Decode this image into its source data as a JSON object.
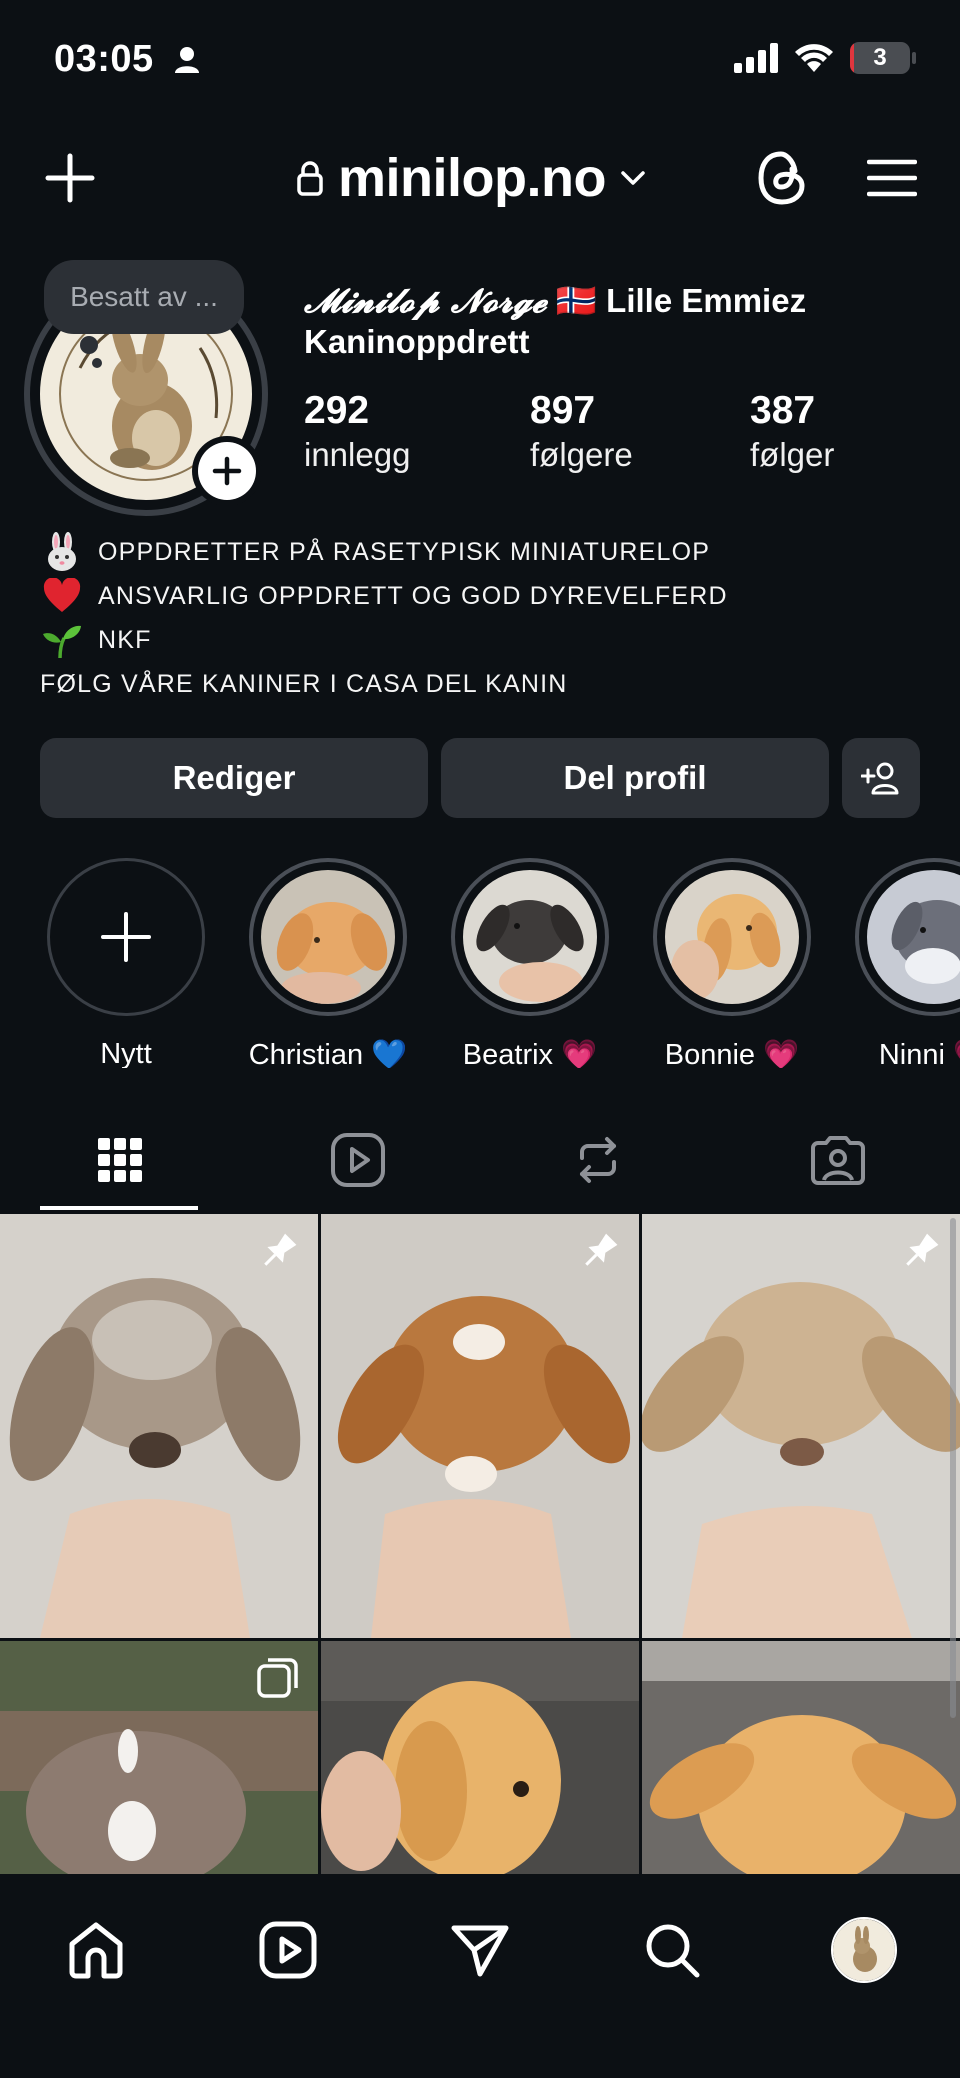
{
  "status_bar": {
    "time": "03:05",
    "battery_level": "3",
    "battery_fraction": 0.03
  },
  "header": {
    "username": "minilop.no",
    "icons": [
      "create-icon",
      "lock-icon",
      "chevron-down-icon",
      "threads-icon",
      "menu-icon"
    ]
  },
  "profile": {
    "note": "Besatt av ...",
    "display_name_script": "𝓜𝓲𝓷𝓲𝓵𝓸𝓹 𝓝𝓸𝓻𝓰𝓮",
    "display_name_flag": "🇳🇴",
    "display_name_rest": "Lille Emmiez Kaninoppdrett",
    "stats": [
      {
        "value": "292",
        "label": "innlegg"
      },
      {
        "value": "897",
        "label": "følgere"
      },
      {
        "value": "387",
        "label": "følger"
      }
    ],
    "bio": [
      {
        "emoji": "rabbit-face",
        "text": "OPPDRETTER PÅ RASETYPISK MINIATURELOP"
      },
      {
        "emoji": "red-heart",
        "text": "ANSVARLIG OPPDRETT OG GOD DYREVELFERD"
      },
      {
        "emoji": "seedling",
        "text": "NKF"
      },
      {
        "emoji": "",
        "text": "FØLG VÅRE KANINER I CASA DEL KANIN"
      }
    ]
  },
  "actions": {
    "edit_label": "Rediger",
    "share_label": "Del profil"
  },
  "highlights": [
    {
      "label": "Nytt"
    },
    {
      "label": "Christian 💙"
    },
    {
      "label": "Beatrix 💗"
    },
    {
      "label": "Bonnie 💗"
    },
    {
      "label": "Ninni 💗"
    }
  ],
  "tabs": [
    "grid-icon",
    "reels-icon",
    "reposts-icon",
    "tagged-icon"
  ],
  "grid": [
    {
      "badge": "pin-icon"
    },
    {
      "badge": "pin-icon"
    },
    {
      "badge": "pin-icon"
    },
    {
      "badge": "carousel-icon"
    },
    {
      "badge": ""
    },
    {
      "badge": ""
    }
  ],
  "bottom_nav": [
    "home-icon",
    "reels-icon",
    "messages-icon",
    "search-icon",
    "profile-avatar"
  ],
  "colors": {
    "background": "#0c1014",
    "button": "#2c3036",
    "battery_low": "#e0363e"
  }
}
